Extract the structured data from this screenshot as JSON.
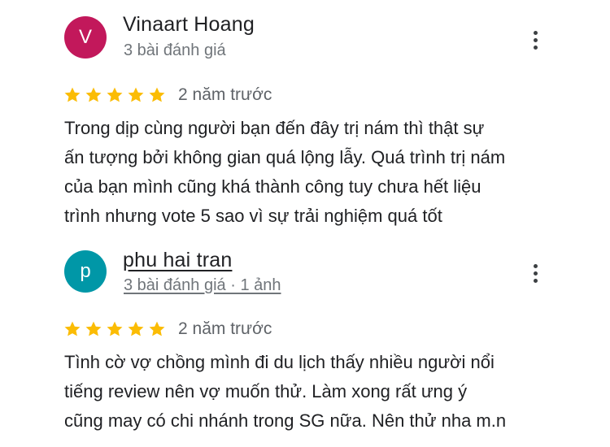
{
  "colors": {
    "star": "#FBBC04",
    "avatar_v": "#C2185B",
    "avatar_p": "#0097A7"
  },
  "reviews": [
    {
      "avatar_letter": "V",
      "name": "Vinaart Hoang",
      "meta": "3 bài đánh giá",
      "rating": 5,
      "time": "2 năm trước",
      "text_lines": [
        "Trong dịp cùng người bạn đến đây trị nám thì thật sự",
        "ấn tượng bởi không gian quá lộng lẫy. Quá trình trị nám",
        "của bạn mình cũng khá thành công tuy chưa hết liệu",
        "trình nhưng vote 5 sao vì sự trải nghiệm quá tốt"
      ],
      "more_icon": "more-vert-icon"
    },
    {
      "avatar_letter": "p",
      "name": "phu hai tran",
      "meta": "3 bài đánh giá · 1 ảnh",
      "rating": 5,
      "time": "2 năm trước",
      "text_lines": [
        "Tình cờ vợ chồng mình đi du lịch thấy nhiều người nổi",
        "tiếng review nên vợ muốn thử. Làm xong rất ưng ý",
        "cũng may có chi nhánh trong SG nữa. Nên thử nha m.n"
      ],
      "more_icon": "more-vert-icon"
    }
  ]
}
